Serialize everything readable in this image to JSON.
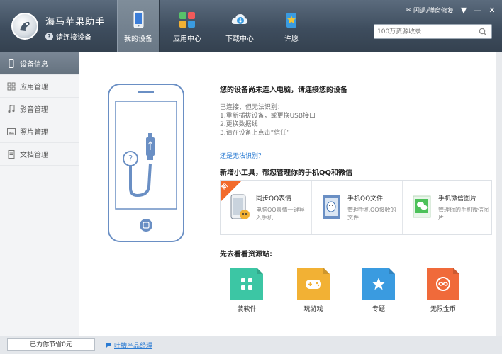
{
  "app": {
    "title": "海马苹果助手",
    "status": "请连接设备"
  },
  "nav": [
    {
      "label": "我的设备",
      "icon": "device-icon",
      "active": true
    },
    {
      "label": "应用中心",
      "icon": "apps-icon",
      "active": false
    },
    {
      "label": "下载中心",
      "icon": "cloud-download-icon",
      "active": false
    },
    {
      "label": "许愿",
      "icon": "wish-icon",
      "active": false
    }
  ],
  "titlebar": {
    "repair_label": "闪退/弹窗修复",
    "menu": "▼",
    "minimize": "—",
    "close": "✕"
  },
  "search": {
    "placeholder": "100万资源收录"
  },
  "sidebar": {
    "items": [
      {
        "label": "设备信息",
        "icon": "phone-icon",
        "active": true
      },
      {
        "label": "应用管理",
        "icon": "grid-icon",
        "active": false
      },
      {
        "label": "影音管理",
        "icon": "music-icon",
        "active": false
      },
      {
        "label": "照片管理",
        "icon": "photo-icon",
        "active": false
      },
      {
        "label": "文档管理",
        "icon": "document-icon",
        "active": false
      }
    ]
  },
  "main": {
    "message_title": "您的设备尚未连入电脑，请连接您的设备",
    "tips": [
      "已连接，但无法识别：",
      "1.重新插拔设备，或更换USB接口",
      "2.更换数据线",
      "3.请在设备上点击“信任”"
    ],
    "unable_link": "还是无法识别？",
    "tools_title": "新增小工具，帮您管理你的手机QQ和微信",
    "new_badge": "新",
    "tools": [
      {
        "name": "同步QQ表情",
        "desc": "电脑QQ表情一键导入手机",
        "icon": "qq-emoji-icon"
      },
      {
        "name": "手机QQ文件",
        "desc": "管理手机QQ接收的文件",
        "icon": "qq-file-icon"
      },
      {
        "name": "手机微信图片",
        "desc": "管理你的手机微信图片",
        "icon": "wechat-photo-icon"
      }
    ],
    "resources_title": "先去看看资源站:",
    "resources": [
      {
        "label": "装软件",
        "color": "#3cc6a4",
        "icon": "apps-grid-icon"
      },
      {
        "label": "玩游戏",
        "color": "#f2b134",
        "icon": "gamepad-icon"
      },
      {
        "label": "专题",
        "color": "#3a9be0",
        "icon": "star-icon"
      },
      {
        "label": "无限金币",
        "color": "#f06a3a",
        "icon": "infinity-icon"
      }
    ]
  },
  "footer": {
    "saved": "已为你节省0元",
    "feedback": "吐槽产品经理"
  },
  "colors": {
    "header_top": "#5b6b7d",
    "header_bottom": "#34414f",
    "device_outline": "#6a8fc4",
    "link": "#2a7bd3"
  }
}
